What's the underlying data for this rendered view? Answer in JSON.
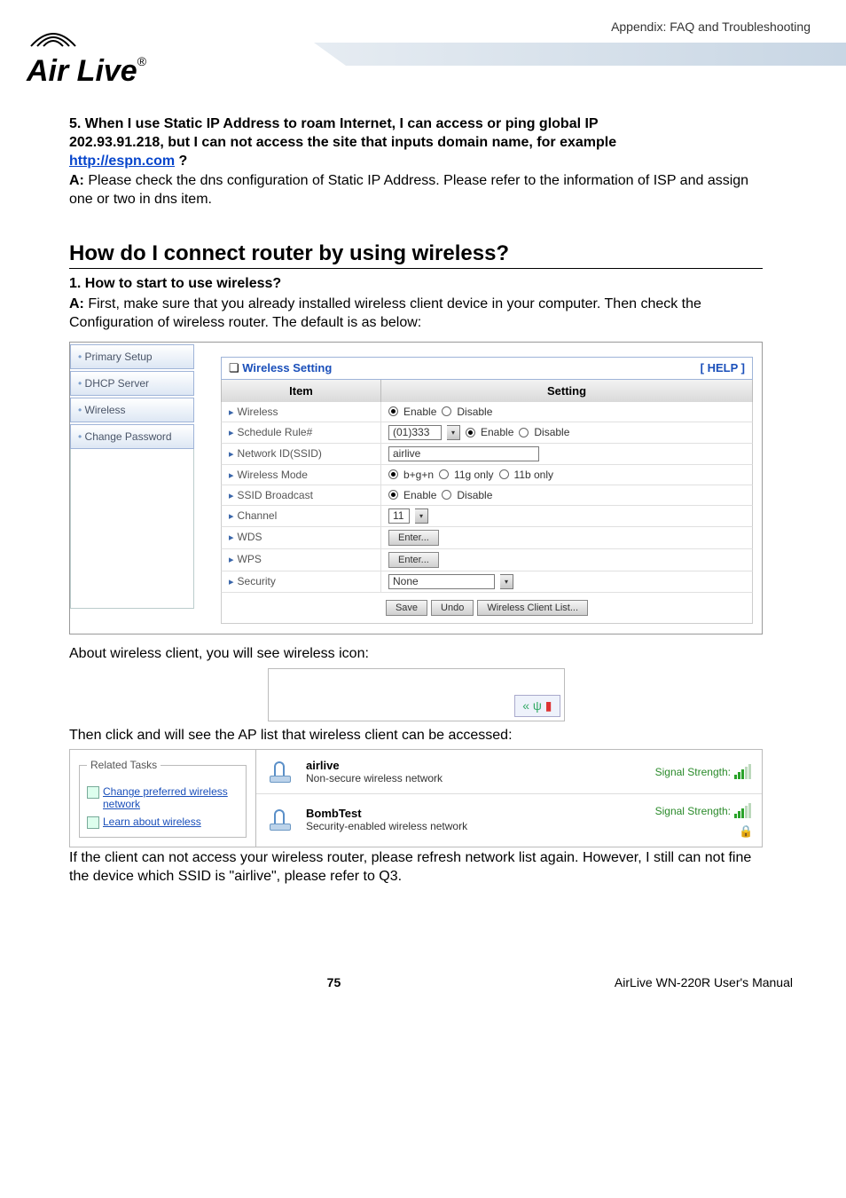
{
  "header": {
    "appendix": "Appendix: FAQ and Troubleshooting",
    "logo_text": "Air Live",
    "logo_reg": "®"
  },
  "q5": {
    "line1": "5. When I use Static IP Address to roam Internet, I can access or ping global IP",
    "line2_pre": "202.93.91.218, but I can not access the site that inputs domain name, for example",
    "link_text": "http://espn.com",
    "link_suffix": " ?",
    "answer_label": "A:",
    "answer_text": " Please check the dns configuration of Static IP Address. Please refer to the information of ISP and assign one or two in dns item."
  },
  "h2": "How do I connect router by using wireless?",
  "q1": {
    "title": "1. How to start to use wireless?",
    "answer_label": "A:",
    "answer_text": " First, make sure that you already installed wireless client device in your computer. Then check the Configuration of wireless router. The default is as below:"
  },
  "sidebar": {
    "items": [
      "Primary Setup",
      "DHCP Server",
      "Wireless",
      "Change Password"
    ]
  },
  "panel": {
    "title_icon": "❏",
    "title": "Wireless Setting",
    "help": "[ HELP ]",
    "th_item": "Item",
    "th_setting": "Setting",
    "rows": {
      "wireless": {
        "label": "Wireless",
        "enable": "Enable",
        "disable": "Disable"
      },
      "schedule": {
        "label": "Schedule Rule#",
        "value": "(01)333",
        "enable": "Enable",
        "disable": "Disable"
      },
      "ssid": {
        "label": "Network ID(SSID)",
        "value": "airlive"
      },
      "mode": {
        "label": "Wireless Mode",
        "opt1": "b+g+n",
        "opt2": "11g only",
        "opt3": "11b only"
      },
      "broadcast": {
        "label": "SSID Broadcast",
        "enable": "Enable",
        "disable": "Disable"
      },
      "channel": {
        "label": "Channel",
        "value": "11"
      },
      "wds": {
        "label": "WDS",
        "btn": "Enter..."
      },
      "wps": {
        "label": "WPS",
        "btn": "Enter..."
      },
      "security": {
        "label": "Security",
        "value": "None"
      }
    },
    "buttons": {
      "save": "Save",
      "undo": "Undo",
      "clientlist": "Wireless Client List..."
    }
  },
  "txt_after_fig1": "About wireless client, you will see wireless icon:",
  "tray_icons": "« ψ",
  "txt_after_fig2": "Then click and will see the AP list that wireless client can be accessed:",
  "fig3": {
    "legend": "Related Tasks",
    "link1": "Change preferred wireless network",
    "link2": "Learn about wireless",
    "ap1": {
      "name": "airlive",
      "sub": "Non-secure wireless network",
      "sig": "Signal Strength:"
    },
    "ap2": {
      "name": "BombTest",
      "sub": "Security-enabled wireless network",
      "sig": "Signal Strength:"
    }
  },
  "txt_after_fig3": "If the client can not access your wireless router, please refresh network list again. However, I still can not fine the device which SSID is \"airlive\", please refer to Q3.",
  "footer": {
    "page": "75",
    "manual": "AirLive WN-220R User's Manual"
  }
}
